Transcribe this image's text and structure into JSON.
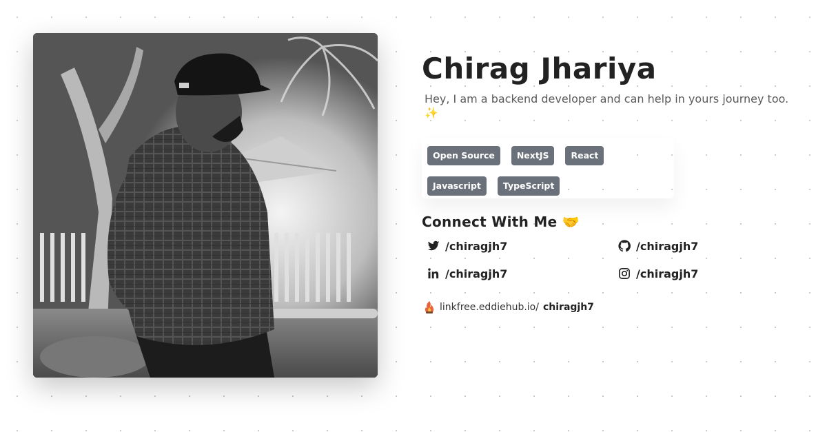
{
  "profile": {
    "name": "Chirag Jhariya",
    "bio": "Hey, I am a backend developer and can help in yours journey too. ✨",
    "photo_icon": "profile-photo"
  },
  "tags": [
    "Open Source",
    "NextJS",
    "React",
    "Javascript",
    "TypeScript"
  ],
  "connect": {
    "title": "Connect With Me 🤝",
    "links": [
      {
        "icon": "twitter-icon",
        "handle": "/chiragjh7"
      },
      {
        "icon": "github-icon",
        "handle": "/chiragjh7"
      },
      {
        "icon": "linkedin-icon",
        "handle": "/chiragjh7"
      },
      {
        "icon": "instagram-icon",
        "handle": "/chiragjh7"
      }
    ]
  },
  "linkfree": {
    "icon": "linkfree-logo",
    "prefix": "linkfree.eddiehub.io/",
    "handle": "chiragjh7"
  },
  "colors": {
    "tag_bg": "#6b717a",
    "text": "#222222",
    "muted": "#5a5a5a"
  }
}
